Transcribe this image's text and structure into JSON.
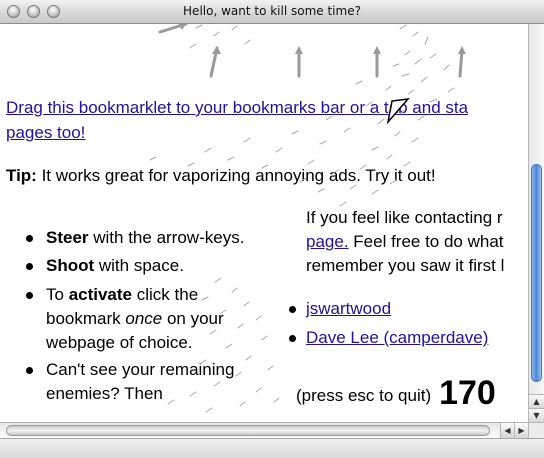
{
  "window": {
    "title": "Hello, want to kill some time?"
  },
  "page": {
    "bookmarklet_link_line1": "Drag this bookmarklet to your bookmarks bar or a tab and sta",
    "bookmarklet_link_line2": "pages too!",
    "tip_label": "Tip:",
    "tip_text": " It works great for vaporizing annoying ads. Try it out!",
    "instructions": [
      {
        "bold": "Steer",
        "rest": " with the arrow-keys."
      },
      {
        "bold": "Shoot",
        "rest": " with space."
      }
    ],
    "activate": {
      "pre": "To ",
      "bold": "activate",
      "post": " click the",
      "line2_pre": "bookmark ",
      "line2_italic": "once",
      "line2_post": " on your",
      "line3": "webpage of choice."
    },
    "enemies": {
      "line1": "Can't see your remaining",
      "line2": "enemies? Then"
    },
    "contact": {
      "line1": "If you feel like contacting r",
      "line2_link": "page.",
      "line2_rest": " Feel free to do what",
      "line3": "remember you saw it first l"
    },
    "authors": [
      "jswartwood",
      "Dave Lee (camperdave)"
    ]
  },
  "game": {
    "quit_hint": "(press esc to quit)",
    "score": "170"
  },
  "colors": {
    "link": "#221199",
    "scroll_thumb": "#4a86d6"
  }
}
